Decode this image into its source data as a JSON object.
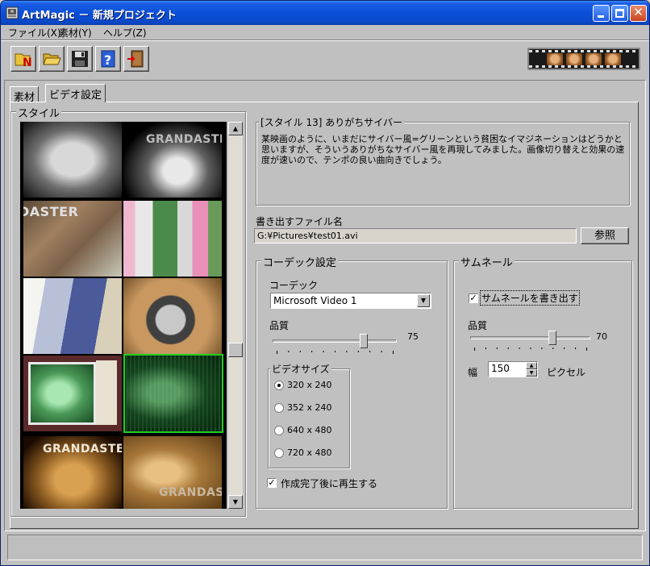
{
  "window": {
    "title": "ArtMagic － 新規プロジェクト"
  },
  "menu": {
    "items": [
      "ファイル(X)",
      "素材(Y)",
      "ヘルプ(Z)"
    ]
  },
  "toolbar": {
    "buttons": [
      "new-project-icon",
      "open-folder-icon",
      "save-disk-icon",
      "help-icon",
      "exit-door-icon"
    ]
  },
  "tabs": [
    {
      "label": "素材",
      "active": false
    },
    {
      "label": "ビデオ設定",
      "active": true
    }
  ],
  "style_group": {
    "label": "スタイル",
    "thumbnails": [
      {
        "caption": ""
      },
      {
        "caption": "GRANDASTER"
      },
      {
        "caption": "DASTER"
      },
      {
        "caption": ""
      },
      {
        "caption": ""
      },
      {
        "caption": ""
      },
      {
        "caption": ""
      },
      {
        "caption": "",
        "selected": true
      },
      {
        "caption": "GRANDASTER"
      },
      {
        "caption": "GRANDAST"
      }
    ]
  },
  "description": {
    "title": "[スタイル 13] ありがちサイバー",
    "body": "某映画のように、いまだにサイバー風=グリーンという貧困なイマジネーションはどうかと思いますが、そういうありがちなサイバー風を再現してみました。画像切り替えと効果の速度が速いので、テンポの良い曲向きでしょう。"
  },
  "output": {
    "label": "書き出すファイル名",
    "value": "G:¥Pictures¥test01.avi",
    "browse_label": "参照"
  },
  "codec": {
    "group_label": "コーデック設定",
    "codec_label": "コーデック",
    "codec_value": "Microsoft Video 1",
    "quality_label": "品質",
    "quality_value": "75",
    "quality_fraction": 0.75,
    "video_size": {
      "label": "ビデオサイズ",
      "options": [
        "320 x 240",
        "352 x 240",
        "640 x 480",
        "720 x 480"
      ],
      "selected": 0
    },
    "play_after_label": "作成完了後に再生する",
    "play_after_checked": true
  },
  "thumbnail": {
    "group_label": "サムネール",
    "write_label": "サムネールを書き出す",
    "write_checked": true,
    "quality_label": "品質",
    "quality_value": "70",
    "quality_fraction": 0.7,
    "width_label": "幅",
    "width_value": "150",
    "width_unit": "ピクセル"
  }
}
